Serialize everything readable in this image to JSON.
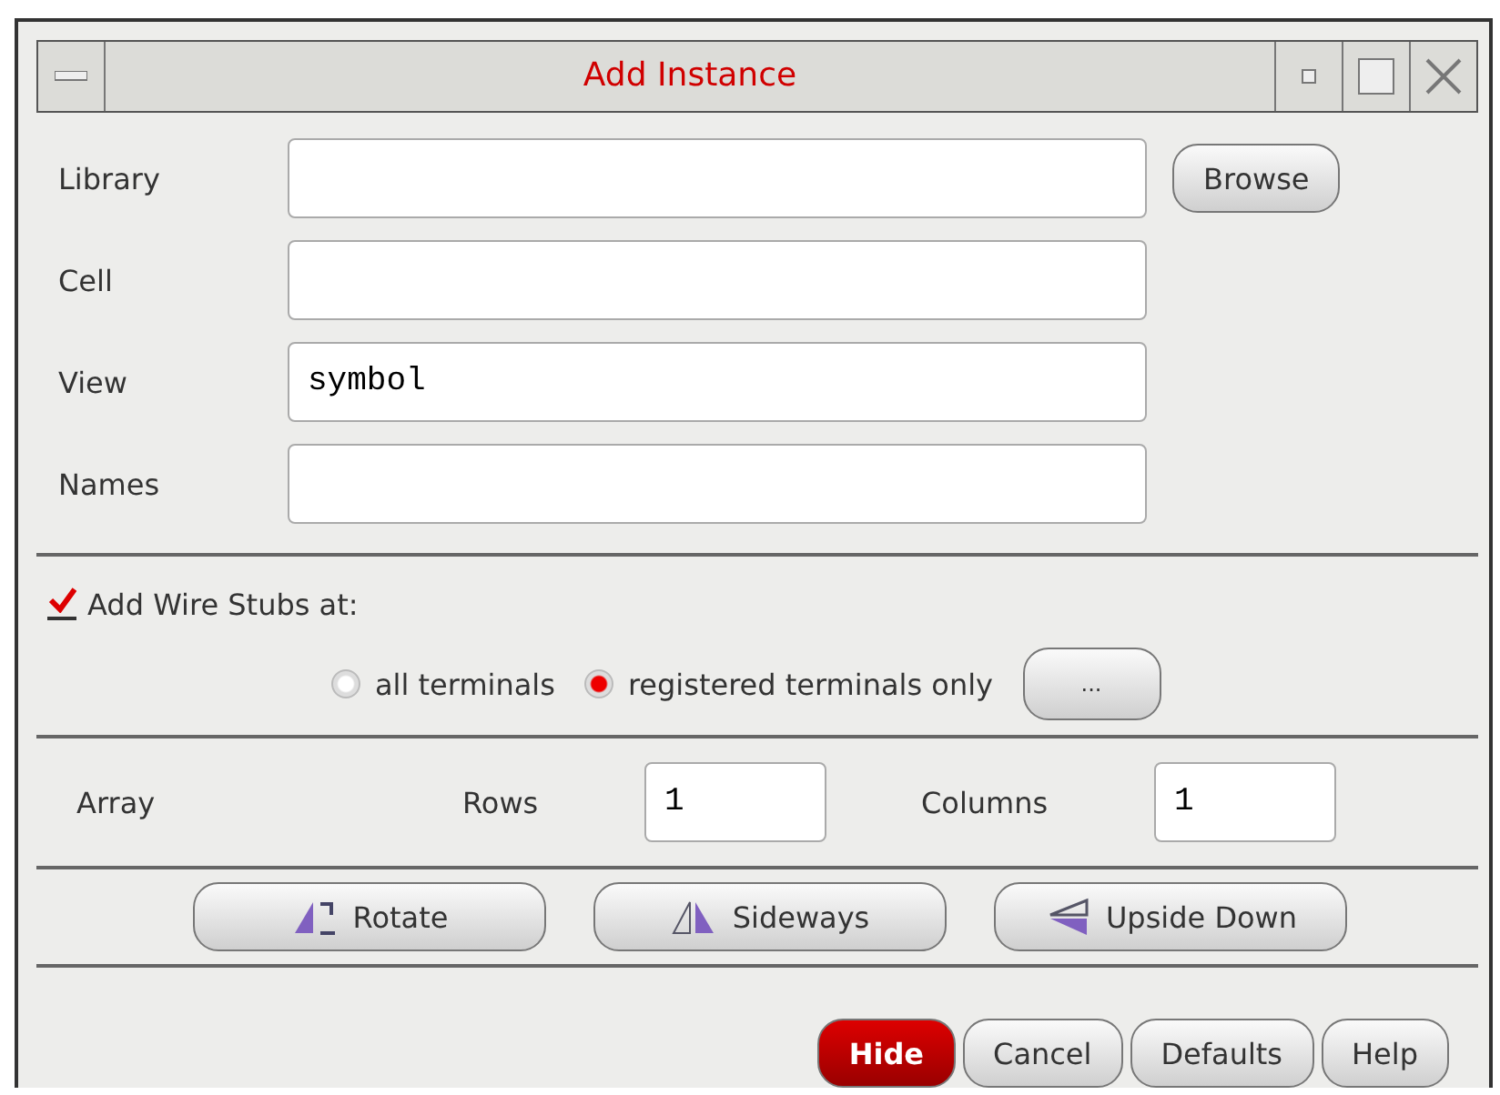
{
  "window": {
    "title": "Add Instance"
  },
  "fields": [
    {
      "label": "Library",
      "button": "Browse"
    },
    {
      "label": "Cell"
    },
    {
      "label": "View",
      "value": "symbol"
    },
    {
      "label": "Names"
    }
  ],
  "wire_stubs": {
    "label": "Add Wire Stubs at:",
    "checked": true,
    "options": [
      {
        "label": "all terminals",
        "selected": false
      },
      {
        "label": "registered terminals only",
        "selected": true
      }
    ],
    "more_button": "..."
  },
  "array": {
    "label": "Array",
    "rows_label": "Rows",
    "rows": "1",
    "columns_label": "Columns",
    "columns": "1"
  },
  "transforms": [
    {
      "kind": "rotate",
      "label": "Rotate"
    },
    {
      "kind": "sideways",
      "label": "Sideways"
    },
    {
      "kind": "upside",
      "label": "Upside Down"
    }
  ],
  "actions": [
    {
      "label": "Hide",
      "primary": true
    },
    {
      "label": "Cancel",
      "primary": false
    },
    {
      "label": "Defaults",
      "primary": false
    },
    {
      "label": "Help",
      "primary": false
    }
  ]
}
